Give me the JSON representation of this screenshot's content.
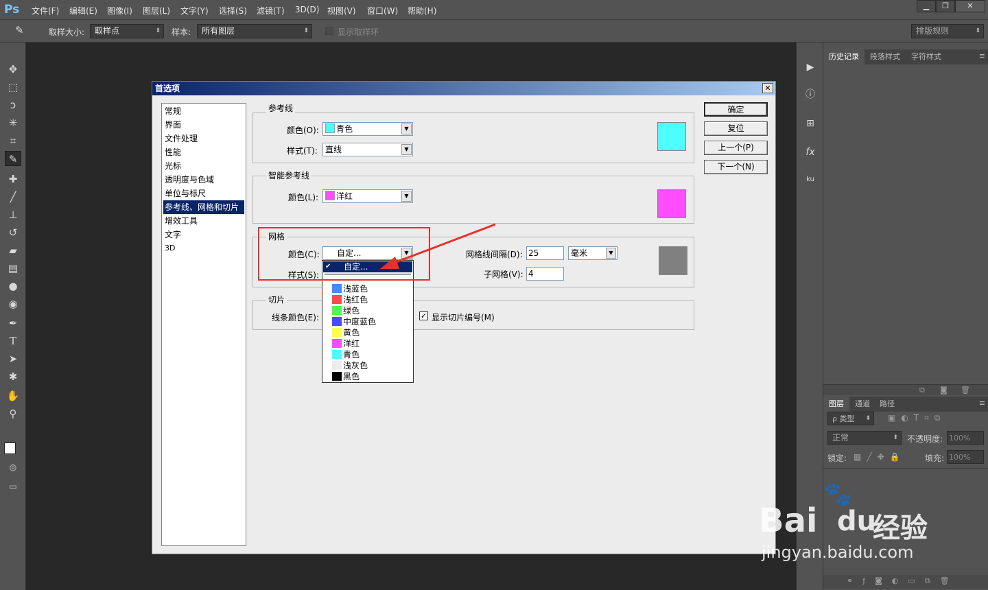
{
  "app": {
    "logo": "Ps"
  },
  "menu": [
    "文件(F)",
    "编辑(E)",
    "图像(I)",
    "图层(L)",
    "文字(Y)",
    "选择(S)",
    "滤镜(T)",
    "3D(D)",
    "视图(V)",
    "窗口(W)",
    "帮助(H)"
  ],
  "window_controls": {
    "minimize": "▁",
    "restore": "❐",
    "close": "✕"
  },
  "options_bar": {
    "sample_size_label": "取样大小:",
    "sample_size_value": "取样点",
    "sample_label": "样本:",
    "sample_value": "所有图层",
    "show_ring_label": "显示取样环",
    "workspace": "排版规则"
  },
  "right_panel": {
    "top_tabs": [
      "历史记录",
      "段落样式",
      "字符样式"
    ],
    "layer_tabs": [
      "图层",
      "通道",
      "路径"
    ],
    "filter_kind": "ρ 类型",
    "blend_mode": "正常",
    "opacity_label": "不透明度:",
    "opacity_value": "100%",
    "lock_label": "锁定:",
    "fill_label": "填充:",
    "fill_value": "100%"
  },
  "dialog": {
    "title": "首选项",
    "categories": [
      "常规",
      "界面",
      "文件处理",
      "性能",
      "光标",
      "透明度与色域",
      "单位与标尺",
      "参考线、网格和切片",
      "增效工具",
      "文字",
      "3D"
    ],
    "selected_category": "参考线、网格和切片",
    "guides": {
      "title": "参考线",
      "color_label": "颜色(O):",
      "color_value": "青色",
      "color_hex": "#4dffff",
      "style_label": "样式(T):",
      "style_value": "直线"
    },
    "smart_guides": {
      "title": "智能参考线",
      "color_label": "颜色(L):",
      "color_value": "洋红",
      "color_hex": "#ff4dff"
    },
    "grid": {
      "title": "网格",
      "color_label": "颜色(C):",
      "color_value": "自定...",
      "style_label": "样式(S):",
      "gridline_label": "网格线间隔(D):",
      "gridline_value": "25",
      "unit_value": "毫米",
      "subdiv_label": "子网格(V):",
      "subdiv_value": "4",
      "preview_hex": "#808080"
    },
    "slices": {
      "title": "切片",
      "line_color_label": "线条颜色(E):",
      "show_numbers_label": "显示切片编号(M)"
    },
    "buttons": {
      "ok": "确定",
      "reset": "复位",
      "prev": "上一个(P)",
      "next": "下一个(N)"
    }
  },
  "dropdown": {
    "selected": "自定...",
    "items": [
      {
        "label": "浅蓝色",
        "hex": "#4a86ff"
      },
      {
        "label": "浅红色",
        "hex": "#ff4a4a"
      },
      {
        "label": "绿色",
        "hex": "#4aff4a"
      },
      {
        "label": "中度蓝色",
        "hex": "#4a4aff"
      },
      {
        "label": "黄色",
        "hex": "#ffff4a"
      },
      {
        "label": "洋红",
        "hex": "#ff4aff"
      },
      {
        "label": "青色",
        "hex": "#4affff"
      },
      {
        "label": "浅灰色",
        "hex": "#ececec"
      },
      {
        "label": "黑色",
        "hex": "#000000"
      }
    ]
  },
  "watermark": {
    "brand": "Bai",
    "brand2": "du",
    "site_cn": "经验",
    "url": "jingyan.baidu.com"
  },
  "colors": {
    "highlight": "#e8302a",
    "selection": "#0a246a"
  }
}
